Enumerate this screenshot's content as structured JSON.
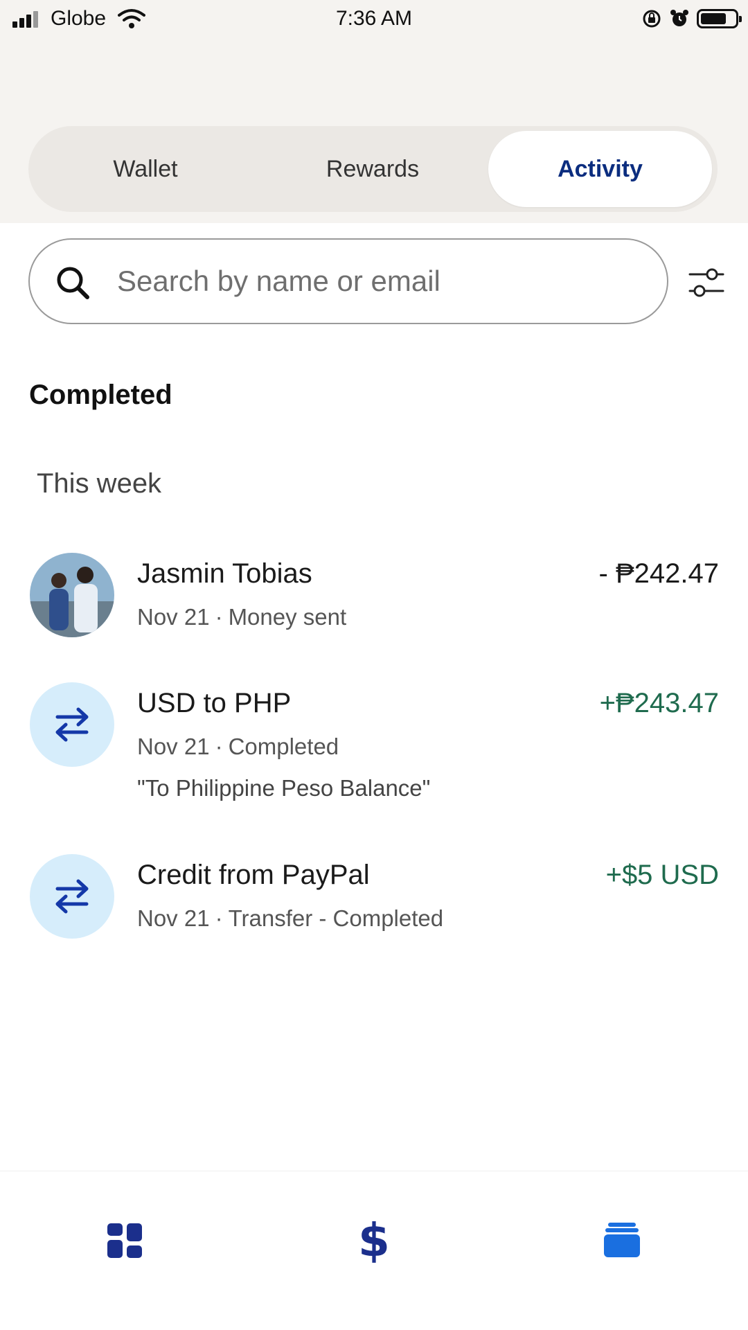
{
  "status_bar": {
    "carrier": "Globe",
    "time": "7:36 AM"
  },
  "tabs": [
    {
      "label": "Wallet",
      "active": false
    },
    {
      "label": "Rewards",
      "active": false
    },
    {
      "label": "Activity",
      "active": true
    }
  ],
  "search": {
    "placeholder": "Search by name or email",
    "value": ""
  },
  "section": {
    "title": "Completed",
    "group": "This week"
  },
  "transactions": [
    {
      "name": "Jasmin Tobias",
      "date": "Nov 21",
      "status": "Money sent",
      "amount": "- ₱242.47",
      "icon": "avatar-photo"
    },
    {
      "name": "USD to PHP",
      "date": "Nov 21",
      "status": "Completed",
      "note": "\"To Philippine Peso Balance\"",
      "amount": "+₱243.47",
      "icon": "transfer-arrows-icon"
    },
    {
      "name": "Credit from PayPal",
      "date": "Nov 21",
      "status": "Transfer - Completed",
      "amount": "+$5 USD",
      "icon": "transfer-arrows-icon"
    }
  ],
  "bottom_nav": {
    "items": [
      {
        "icon": "dashboard-grid-icon",
        "active": false
      },
      {
        "icon": "dollar-icon",
        "active": false
      },
      {
        "icon": "activity-stack-icon",
        "active": true
      }
    ]
  },
  "colors": {
    "brand_navy": "#0b2d7f",
    "active_blue": "#1a6fe0",
    "positive_green": "#1f6b4e",
    "icon_bg": "#d6edfb"
  }
}
